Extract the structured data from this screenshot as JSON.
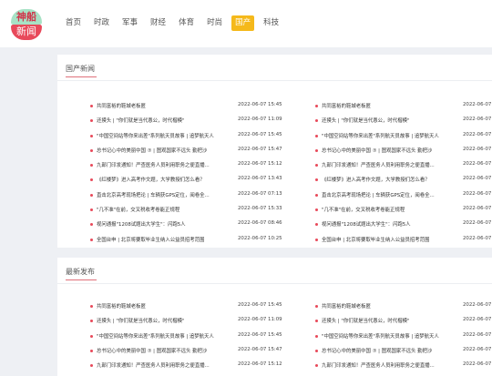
{
  "logo": {
    "top": "神船",
    "bottom": "新闻"
  },
  "nav": [
    {
      "label": "首页",
      "active": false
    },
    {
      "label": "时政",
      "active": false
    },
    {
      "label": "军事",
      "active": false
    },
    {
      "label": "财经",
      "active": false
    },
    {
      "label": "体育",
      "active": false
    },
    {
      "label": "时尚",
      "active": false
    },
    {
      "label": "国产",
      "active": true
    },
    {
      "label": "科技",
      "active": false
    }
  ],
  "sections": [
    {
      "title": "国产新闻",
      "columns": [
        [
          {
            "title": "共同富裕的鞋城老板匿",
            "date": "2022-06-07 15:45"
          },
          {
            "title": "还摸头 | \"你们就是当代愚公，时代楷模\"",
            "date": "2022-06-07 11:09"
          },
          {
            "title": "\"中国空间站等你来出差\"系列航天员故事 | 追梦航天人",
            "date": "2022-06-07 15:45"
          },
          {
            "title": "总书记心中的美丽中国 ⑦ | 图观国家不远头 勤把沙",
            "date": "2022-06-07 15:47"
          },
          {
            "title": "九部门印发通知！严查医务人员利用职务之便直播...",
            "date": "2022-06-07 15:12"
          },
          {
            "title": "《红楼梦》进入高考作文题，大学教授们怎么看？",
            "date": "2022-06-07 13:43"
          },
          {
            "title": "直击北京高考现场把论 | 车辆获GPS定位，阅卷全...",
            "date": "2022-06-07 07:13"
          },
          {
            "title": "\"几不准\"在前，交叉税收考卷能正规程",
            "date": "2022-06-07 15:33"
          },
          {
            "title": "视问通报\"1208试题出大学生\"：闪跑5人",
            "date": "2022-06-07 08:46"
          },
          {
            "title": "全国台申 | 北京将要取毕业生纳入公益员招考范围",
            "date": "2022-06-07 10:25"
          }
        ],
        [
          {
            "title": "共同富裕的鞋城老板匿",
            "date": "2022-06-07"
          },
          {
            "title": "还摸头 | \"你们就是当代愚公，时代楷模\"",
            "date": "2022-06-07"
          },
          {
            "title": "\"中国空间站等你来出差\"系列航天员故事 | 追梦航天人",
            "date": "2022-06-07"
          },
          {
            "title": "总书记心中的美丽中国 ⑦ | 图观国家不远头 勤把沙",
            "date": "2022-06-07"
          },
          {
            "title": "九部门印发通知！严查医务人员利用职务之便直播...",
            "date": "2022-06-07"
          },
          {
            "title": "《红楼梦》进入高考作文题，大学教授们怎么看？",
            "date": "2022-06-07"
          },
          {
            "title": "直击北京高考现场把论 | 车辆获GPS定位，阅卷全...",
            "date": "2022-06-07"
          },
          {
            "title": "\"几不准\"在前，交叉税收考卷能正规程",
            "date": "2022-06-07"
          },
          {
            "title": "视问通报\"1208试题出大学生\"：闪跑5人",
            "date": "2022-06-07"
          },
          {
            "title": "全国台申 | 北京将要取毕业生纳入公益员招考范围",
            "date": "2022-06-07"
          }
        ]
      ]
    },
    {
      "title": "最新发布",
      "columns": [
        [
          {
            "title": "共同富裕的鞋城老板匿",
            "date": "2022-06-07 15:45"
          },
          {
            "title": "还摸头 | \"你们就是当代愚公，时代楷模\"",
            "date": "2022-06-07 11:09"
          },
          {
            "title": "\"中国空间站等你来出差\"系列航天员故事 | 追梦航天人",
            "date": "2022-06-07 15:45"
          },
          {
            "title": "总书记心中的美丽中国 ⑦ | 图观国家不远头 勤把沙",
            "date": "2022-06-07 15:47"
          },
          {
            "title": "九部门印发通知！严查医务人员利用职务之便直播...",
            "date": "2022-06-07 15:12"
          }
        ],
        [
          {
            "title": "共同富裕的鞋城老板匿",
            "date": "2022-06-07"
          },
          {
            "title": "还摸头 | \"你们就是当代愚公，时代楷模\"",
            "date": "2022-06-07"
          },
          {
            "title": "\"中国空间站等你来出差\"系列航天员故事 | 追梦航天人",
            "date": "2022-06-07"
          },
          {
            "title": "总书记心中的美丽中国 ⑦ | 图观国家不远头 勤把沙",
            "date": "2022-06-07"
          },
          {
            "title": "九部门印发通知！严查医务人员利用职务之便直播...",
            "date": "2022-06-07"
          }
        ]
      ]
    }
  ]
}
